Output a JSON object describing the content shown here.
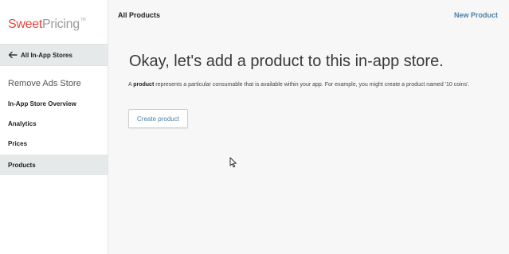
{
  "logo": {
    "part1": "Sweet",
    "part2": "Pricing",
    "tm": "TM"
  },
  "sidebar": {
    "back_label": "All In-App Stores",
    "back_icon": "arrow-left-icon",
    "store_name": "Remove Ads Store",
    "items": [
      {
        "label": "In-App Store Overview",
        "active": false
      },
      {
        "label": "Analytics",
        "active": false
      },
      {
        "label": "Prices",
        "active": false
      },
      {
        "label": "Products",
        "active": true
      }
    ]
  },
  "header": {
    "title": "All Products",
    "new_product_label": "New Product"
  },
  "main": {
    "headline": "Okay, let's add a product to this in-app store.",
    "desc_prefix": "A ",
    "desc_bold": "product",
    "desc_rest": " represents a particular consumable that is available within your app. For example, you might create a product named '10 coins'.",
    "create_button_label": "Create product"
  },
  "colors": {
    "brand_red": "#e8463b",
    "link_blue": "#4a7fa8",
    "active_bg": "#e6e9ea"
  }
}
